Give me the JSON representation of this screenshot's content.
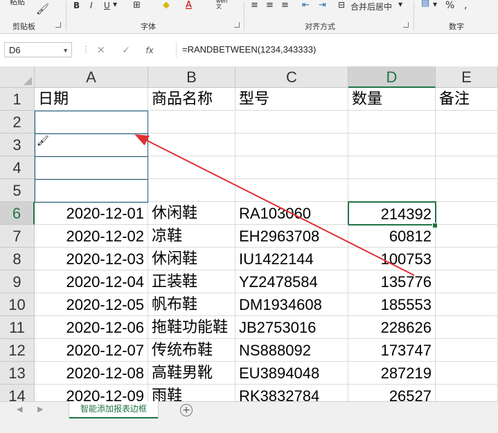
{
  "ribbon": {
    "paste_label": "粘贴",
    "clipboard_label": "剪贴板",
    "font_label": "字体",
    "alignment_label": "对齐方式",
    "number_label": "数字",
    "merge_center_label": "合并后居中",
    "percent_label": "%",
    "comma_label": ",",
    "phonetic_label": "wén\n文"
  },
  "formula_bar": {
    "name_box": "D6",
    "fx_label": "fx",
    "formula": "=RANDBETWEEN(1234,343333)"
  },
  "columns": [
    "A",
    "B",
    "C",
    "D",
    "E"
  ],
  "selected_column": "D",
  "rows": [
    "1",
    "2",
    "3",
    "4",
    "5",
    "6",
    "7",
    "8",
    "9",
    "10",
    "11",
    "12",
    "13",
    "14"
  ],
  "selected_row": "6",
  "header_row": {
    "a": "日期",
    "b": "商品名称",
    "c": "型号",
    "d": "数量",
    "e": "备注"
  },
  "data_rows": [
    {
      "date": "2020-12-01",
      "name": "休闲鞋",
      "model": "RA103060",
      "qty": "214392"
    },
    {
      "date": "2020-12-02",
      "name": "凉鞋",
      "model": "EH2963708",
      "qty": "60812"
    },
    {
      "date": "2020-12-03",
      "name": "休闲鞋",
      "model": "IU1422144",
      "qty": "100753"
    },
    {
      "date": "2020-12-04",
      "name": "正装鞋",
      "model": "YZ2478584",
      "qty": "135776"
    },
    {
      "date": "2020-12-05",
      "name": "帆布鞋",
      "model": "DM1934608",
      "qty": "185553"
    },
    {
      "date": "2020-12-06",
      "name": "拖鞋功能鞋",
      "model": "JB2753016",
      "qty": "228626"
    },
    {
      "date": "2020-12-07",
      "name": "传统布鞋",
      "model": "NS888092",
      "qty": "173747"
    },
    {
      "date": "2020-12-08",
      "name": "高鞋男靴",
      "model": "EU3894048",
      "qty": "287219"
    },
    {
      "date": "2020-12-09",
      "name": "雨鞋",
      "model": "RK3832784",
      "qty": "26527"
    }
  ],
  "sheet_tab": "智能添加报表边框",
  "colors": {
    "accent": "#217346",
    "border_applied": "#1f5e7e",
    "annotation_arrow": "#e03030"
  },
  "icons": [
    "paste-icon",
    "format-painter-icon",
    "bold-icon",
    "italic-icon",
    "underline-icon",
    "borders-icon",
    "fill-color-icon",
    "font-color-icon",
    "phonetic-icon",
    "align-icons",
    "merge-center-icon",
    "percent-icon",
    "cancel-icon",
    "enter-icon",
    "fx-icon",
    "brush-cursor-icon",
    "add-sheet-icon"
  ]
}
